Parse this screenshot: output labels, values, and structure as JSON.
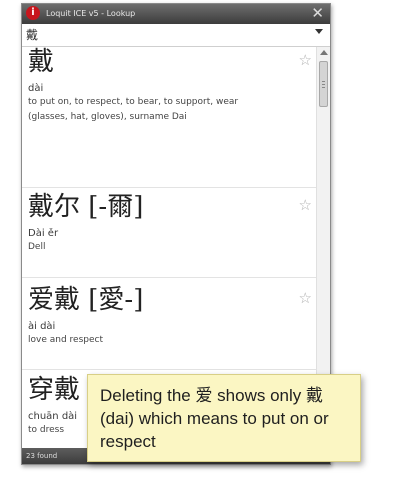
{
  "window": {
    "title": "Loquit ICE v5 - Lookup",
    "app_icon": "i",
    "close_glyph": "✕"
  },
  "search": {
    "value": "戴"
  },
  "entries": [
    {
      "headword": "戴",
      "pinyin": "dài",
      "definition": "to put on, to respect, to bear, to support, wear (glasses, hat, gloves), surname Dai",
      "star": "☆"
    },
    {
      "headword": "戴尔 [-爾]",
      "pinyin": "Dài ěr",
      "definition": "Dell",
      "star": "☆"
    },
    {
      "headword": "爱戴 [愛-]",
      "pinyin": "ài dài",
      "definition": "love and respect",
      "star": "☆"
    },
    {
      "headword": "穿戴",
      "pinyin": "chuān dài",
      "definition": "to dress",
      "star": "☆"
    }
  ],
  "status": {
    "text": "23 found"
  },
  "callout": {
    "text": "Deleting the 爱 shows only 戴 (dai) which means to put on or respect"
  },
  "colors": {
    "titlebar": "#4a4a4a",
    "app_icon": "#c8161d",
    "callout_background": "#fbf6c3"
  },
  "icons": [
    "app-icon",
    "close-icon",
    "dropdown-arrow-icon",
    "star-icon",
    "scroll-up-icon"
  ]
}
